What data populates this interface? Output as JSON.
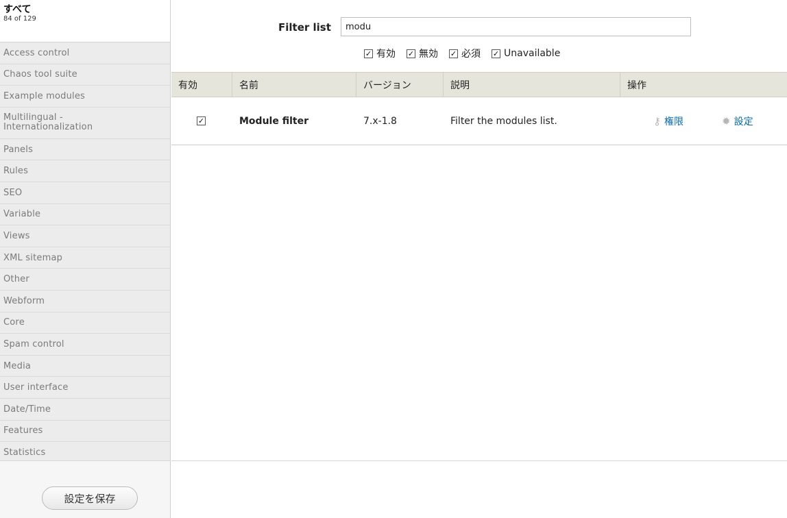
{
  "sidebar": {
    "all_title": "すべて",
    "all_count": "84 of 129",
    "categories": [
      "Access control",
      "Chaos tool suite",
      "Example modules",
      "Multilingual -",
      "Internationalization",
      "Panels",
      "Rules",
      "SEO",
      "Variable",
      "Views",
      "XML sitemap",
      "Other",
      "Webform",
      "Core",
      "Spam control",
      "Media",
      "User interface",
      "Date/Time",
      "Features",
      "Statistics"
    ],
    "save_label": "設定を保存"
  },
  "filter": {
    "label": "Filter list",
    "value": "modu",
    "checks": [
      "有効",
      "無効",
      "必須",
      "Unavailable"
    ]
  },
  "table": {
    "headers": [
      "有効",
      "名前",
      "バージョン",
      "説明",
      "操作"
    ],
    "row": {
      "name": "Module filter",
      "version": "7.x-1.8",
      "description": "Filter the modules list.",
      "op_permissions": "権限",
      "op_settings": "設定"
    }
  },
  "colors": {
    "link": "#0a6cb2",
    "header_bg": "#e5e5dc",
    "sidebar_bg": "#ececec"
  }
}
